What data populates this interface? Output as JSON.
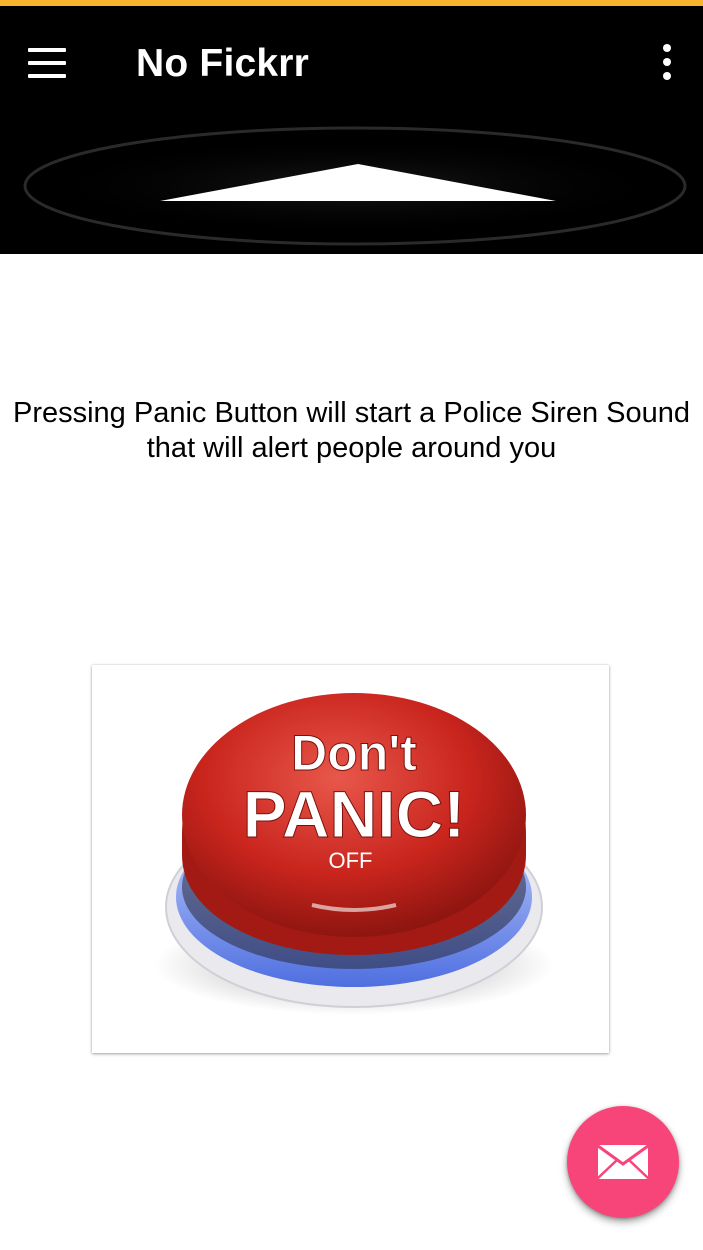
{
  "app_bar": {
    "title": "No Fickrr",
    "accent_color": "#f7b52b",
    "background_color": "#000000",
    "menu_icon": "hamburger-menu-icon",
    "overflow_icon": "more-vert-icon"
  },
  "main": {
    "description_line1": "Pressing Panic Button will start a Police Siren Sound",
    "description_line2": "that will alert people around you",
    "panic_button": {
      "text_top": "Don't",
      "text_bottom": "PANIC!",
      "state_label": "OFF",
      "button_color": "#d4312a"
    }
  },
  "fab": {
    "icon": "email-icon",
    "color": "#f7457a"
  }
}
